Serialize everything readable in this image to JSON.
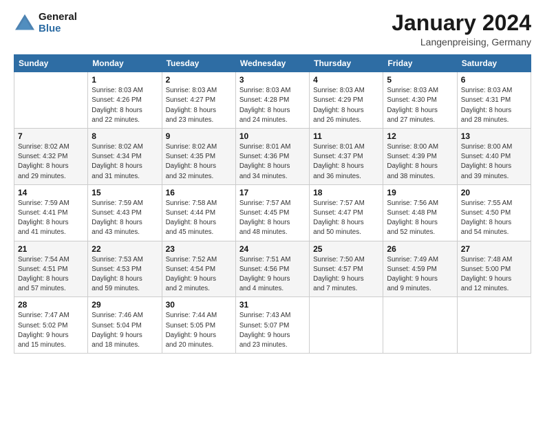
{
  "header": {
    "logo_line1": "General",
    "logo_line2": "Blue",
    "month_title": "January 2024",
    "location": "Langenpreising, Germany"
  },
  "days_of_week": [
    "Sunday",
    "Monday",
    "Tuesday",
    "Wednesday",
    "Thursday",
    "Friday",
    "Saturday"
  ],
  "weeks": [
    [
      {
        "day": "",
        "info": ""
      },
      {
        "day": "1",
        "info": "Sunrise: 8:03 AM\nSunset: 4:26 PM\nDaylight: 8 hours\nand 22 minutes."
      },
      {
        "day": "2",
        "info": "Sunrise: 8:03 AM\nSunset: 4:27 PM\nDaylight: 8 hours\nand 23 minutes."
      },
      {
        "day": "3",
        "info": "Sunrise: 8:03 AM\nSunset: 4:28 PM\nDaylight: 8 hours\nand 24 minutes."
      },
      {
        "day": "4",
        "info": "Sunrise: 8:03 AM\nSunset: 4:29 PM\nDaylight: 8 hours\nand 26 minutes."
      },
      {
        "day": "5",
        "info": "Sunrise: 8:03 AM\nSunset: 4:30 PM\nDaylight: 8 hours\nand 27 minutes."
      },
      {
        "day": "6",
        "info": "Sunrise: 8:03 AM\nSunset: 4:31 PM\nDaylight: 8 hours\nand 28 minutes."
      }
    ],
    [
      {
        "day": "7",
        "info": "Sunrise: 8:02 AM\nSunset: 4:32 PM\nDaylight: 8 hours\nand 29 minutes."
      },
      {
        "day": "8",
        "info": "Sunrise: 8:02 AM\nSunset: 4:34 PM\nDaylight: 8 hours\nand 31 minutes."
      },
      {
        "day": "9",
        "info": "Sunrise: 8:02 AM\nSunset: 4:35 PM\nDaylight: 8 hours\nand 32 minutes."
      },
      {
        "day": "10",
        "info": "Sunrise: 8:01 AM\nSunset: 4:36 PM\nDaylight: 8 hours\nand 34 minutes."
      },
      {
        "day": "11",
        "info": "Sunrise: 8:01 AM\nSunset: 4:37 PM\nDaylight: 8 hours\nand 36 minutes."
      },
      {
        "day": "12",
        "info": "Sunrise: 8:00 AM\nSunset: 4:39 PM\nDaylight: 8 hours\nand 38 minutes."
      },
      {
        "day": "13",
        "info": "Sunrise: 8:00 AM\nSunset: 4:40 PM\nDaylight: 8 hours\nand 39 minutes."
      }
    ],
    [
      {
        "day": "14",
        "info": "Sunrise: 7:59 AM\nSunset: 4:41 PM\nDaylight: 8 hours\nand 41 minutes."
      },
      {
        "day": "15",
        "info": "Sunrise: 7:59 AM\nSunset: 4:43 PM\nDaylight: 8 hours\nand 43 minutes."
      },
      {
        "day": "16",
        "info": "Sunrise: 7:58 AM\nSunset: 4:44 PM\nDaylight: 8 hours\nand 45 minutes."
      },
      {
        "day": "17",
        "info": "Sunrise: 7:57 AM\nSunset: 4:45 PM\nDaylight: 8 hours\nand 48 minutes."
      },
      {
        "day": "18",
        "info": "Sunrise: 7:57 AM\nSunset: 4:47 PM\nDaylight: 8 hours\nand 50 minutes."
      },
      {
        "day": "19",
        "info": "Sunrise: 7:56 AM\nSunset: 4:48 PM\nDaylight: 8 hours\nand 52 minutes."
      },
      {
        "day": "20",
        "info": "Sunrise: 7:55 AM\nSunset: 4:50 PM\nDaylight: 8 hours\nand 54 minutes."
      }
    ],
    [
      {
        "day": "21",
        "info": "Sunrise: 7:54 AM\nSunset: 4:51 PM\nDaylight: 8 hours\nand 57 minutes."
      },
      {
        "day": "22",
        "info": "Sunrise: 7:53 AM\nSunset: 4:53 PM\nDaylight: 8 hours\nand 59 minutes."
      },
      {
        "day": "23",
        "info": "Sunrise: 7:52 AM\nSunset: 4:54 PM\nDaylight: 9 hours\nand 2 minutes."
      },
      {
        "day": "24",
        "info": "Sunrise: 7:51 AM\nSunset: 4:56 PM\nDaylight: 9 hours\nand 4 minutes."
      },
      {
        "day": "25",
        "info": "Sunrise: 7:50 AM\nSunset: 4:57 PM\nDaylight: 9 hours\nand 7 minutes."
      },
      {
        "day": "26",
        "info": "Sunrise: 7:49 AM\nSunset: 4:59 PM\nDaylight: 9 hours\nand 9 minutes."
      },
      {
        "day": "27",
        "info": "Sunrise: 7:48 AM\nSunset: 5:00 PM\nDaylight: 9 hours\nand 12 minutes."
      }
    ],
    [
      {
        "day": "28",
        "info": "Sunrise: 7:47 AM\nSunset: 5:02 PM\nDaylight: 9 hours\nand 15 minutes."
      },
      {
        "day": "29",
        "info": "Sunrise: 7:46 AM\nSunset: 5:04 PM\nDaylight: 9 hours\nand 18 minutes."
      },
      {
        "day": "30",
        "info": "Sunrise: 7:44 AM\nSunset: 5:05 PM\nDaylight: 9 hours\nand 20 minutes."
      },
      {
        "day": "31",
        "info": "Sunrise: 7:43 AM\nSunset: 5:07 PM\nDaylight: 9 hours\nand 23 minutes."
      },
      {
        "day": "",
        "info": ""
      },
      {
        "day": "",
        "info": ""
      },
      {
        "day": "",
        "info": ""
      }
    ]
  ]
}
